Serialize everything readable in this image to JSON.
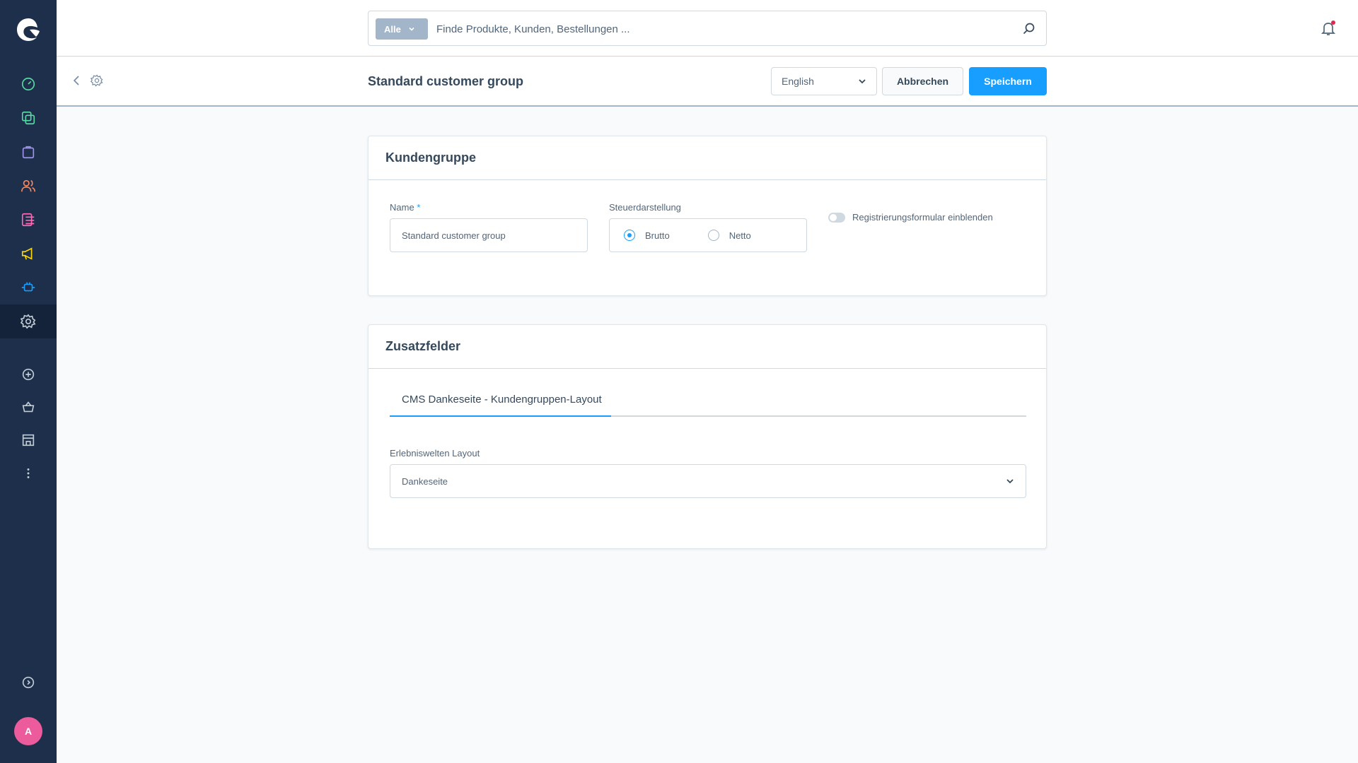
{
  "app": {
    "user_initial": "A"
  },
  "sidebar": {
    "items": [
      {
        "name": "dashboard-icon",
        "color": "#57d9a3"
      },
      {
        "name": "catalog-icon",
        "color": "#57d9a3"
      },
      {
        "name": "orders-icon",
        "color": "#a092f0"
      },
      {
        "name": "customers-icon",
        "color": "#f88962"
      },
      {
        "name": "content-icon",
        "color": "#ff68b4"
      },
      {
        "name": "marketing-icon",
        "color": "#ffd700"
      },
      {
        "name": "extensions-icon",
        "color": "#189eff"
      },
      {
        "name": "settings-icon",
        "color": "#9aa8b5"
      }
    ],
    "secondary": [
      "add-sales-channel-icon",
      "storefront-icon",
      "shop-icon",
      "more-icon"
    ],
    "collapse_icon": "collapse-icon"
  },
  "search": {
    "type_label": "Alle",
    "placeholder": "Finde Produkte, Kunden, Bestellungen ..."
  },
  "header": {
    "title": "Standard customer group",
    "language": "English",
    "cancel_label": "Abbrechen",
    "save_label": "Speichern"
  },
  "card_customer_group": {
    "title": "Kundengruppe",
    "name_label": "Name",
    "name_required": "*",
    "name_value": "Standard customer group",
    "tax_label": "Steuerdarstellung",
    "tax_options": [
      "Brutto",
      "Netto"
    ],
    "tax_selected": "Brutto",
    "registration_toggle_label": "Registrierungsformular einblenden",
    "registration_toggle_on": false
  },
  "card_custom_fields": {
    "title": "Zusatzfelder",
    "tab_label": "CMS Dankeseite - Kundengruppen-Layout",
    "layout_label": "Erlebniswelten Layout",
    "layout_value": "Dankeseite"
  },
  "colors": {
    "primary": "#189eff",
    "sidebar_bg": "#1d2f4a",
    "notification_dot": "#de294c"
  }
}
